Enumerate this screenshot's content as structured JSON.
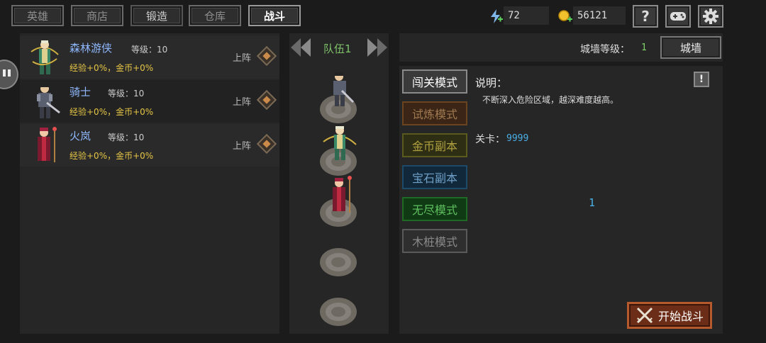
{
  "tabs": [
    {
      "label": "英雄"
    },
    {
      "label": "商店"
    },
    {
      "label": "锻造"
    },
    {
      "label": "仓库"
    },
    {
      "label": "战斗"
    }
  ],
  "resources": {
    "energy": "72",
    "gold": "56121"
  },
  "heroes": [
    {
      "name": "森林游侠",
      "level_label": "等级：10",
      "stats": "经验+0%，金币+0%",
      "deploy": "上阵"
    },
    {
      "name": "骑士",
      "level_label": "等级：10",
      "stats": "经验+0%，金币+0%",
      "deploy": "上阵"
    },
    {
      "name": "火岚",
      "level_label": "等级：10",
      "stats": "经验+0%，金币+0%",
      "deploy": "上阵"
    }
  ],
  "team": {
    "label": "队伍1"
  },
  "wall": {
    "label": "城墙等级：",
    "level": "1",
    "button": "城墙"
  },
  "modes": [
    {
      "label": "闯关模式"
    },
    {
      "label": "试炼模式"
    },
    {
      "label": "金币副本"
    },
    {
      "label": "宝石副本"
    },
    {
      "label": "无尽模式"
    },
    {
      "label": "木桩模式"
    }
  ],
  "description": {
    "title": "说明：",
    "text": "不断深入危险区域，越深难度越高。"
  },
  "stage": {
    "label": "关卡：",
    "value": "9999"
  },
  "center_number": "1",
  "start_button": "开始战斗",
  "colors": {
    "gold_text": "#e6c645",
    "hero_name": "#8fb8ff",
    "number_blue": "#4ab0e8"
  }
}
